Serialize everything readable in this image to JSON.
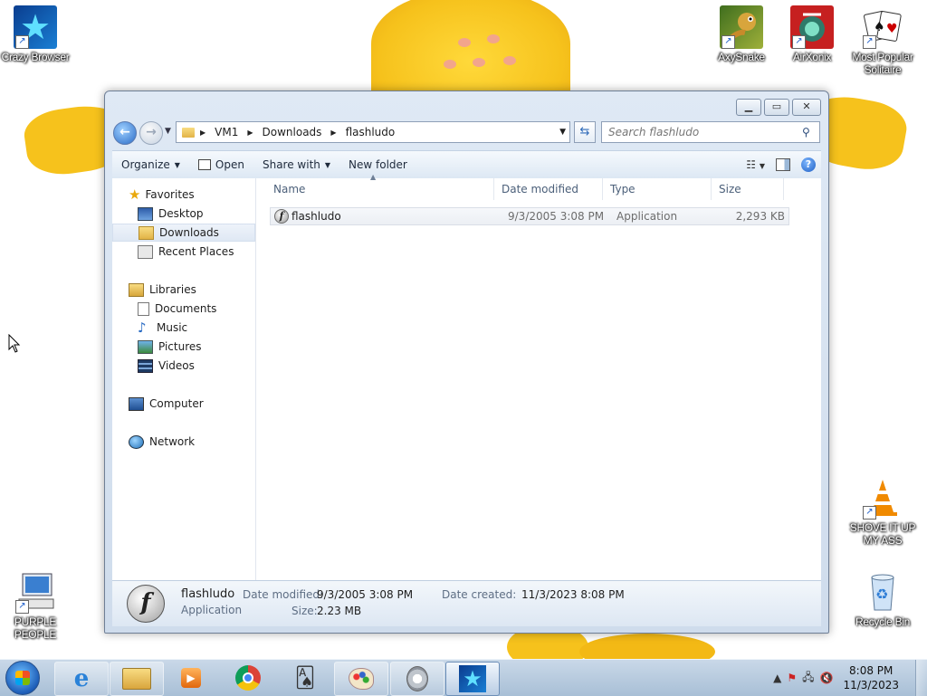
{
  "desktop": {
    "icons": [
      {
        "label": "Crazy Browser",
        "icon": "star-icon"
      },
      {
        "label": "AxySnake",
        "icon": "snake-game-icon"
      },
      {
        "label": "AirXonix",
        "icon": "airxonix-icon"
      },
      {
        "label": "Most Popular Solitaire",
        "icon": "playing-cards-icon"
      },
      {
        "label": "SHOVE IT UP MY ASS",
        "icon": "vlc-cone-icon"
      },
      {
        "label": "PURPLE PEOPLE",
        "icon": "computer-keyboard-icon"
      },
      {
        "label": "Recycle Bin",
        "icon": "recycle-bin-icon"
      }
    ]
  },
  "explorer": {
    "breadcrumb": [
      "VM1",
      "Downloads",
      "flashludo"
    ],
    "search_placeholder": "Search flashludo",
    "toolbar": {
      "organize": "Organize",
      "open": "Open",
      "share_with": "Share with",
      "new_folder": "New folder"
    },
    "nav": {
      "favorites": "Favorites",
      "desktop": "Desktop",
      "downloads": "Downloads",
      "recent_places": "Recent Places",
      "libraries": "Libraries",
      "documents": "Documents",
      "music": "Music",
      "pictures": "Pictures",
      "videos": "Videos",
      "computer": "Computer",
      "network": "Network"
    },
    "columns": {
      "name": "Name",
      "date_modified": "Date modified",
      "type": "Type",
      "size": "Size"
    },
    "files": [
      {
        "name": "flashludo",
        "date_modified": "9/3/2005 3:08 PM",
        "type": "Application",
        "size": "2,293 KB"
      }
    ],
    "details": {
      "name": "flashludo",
      "type": "Application",
      "date_modified_label": "Date modified:",
      "date_modified": "9/3/2005 3:08 PM",
      "size_label": "Size:",
      "size": "2.23 MB",
      "date_created_label": "Date created:",
      "date_created": "11/3/2023 8:08 PM"
    }
  },
  "taskbar": {
    "pinned": [
      "internet-explorer-icon",
      "explorer-folder-icon",
      "media-player-icon",
      "chrome-icon",
      "solitaire-icon",
      "paint-icon",
      "speaker-app-icon",
      "crazy-browser-icon"
    ],
    "clock_time": "8:08 PM",
    "clock_date": "11/3/2023"
  },
  "colors": {
    "wallpaper_yellow": "#f6c21c",
    "taskbar": "#b7cbe0",
    "window_frame": "#d4e0ee",
    "accent_blue": "#1f5fc4"
  }
}
